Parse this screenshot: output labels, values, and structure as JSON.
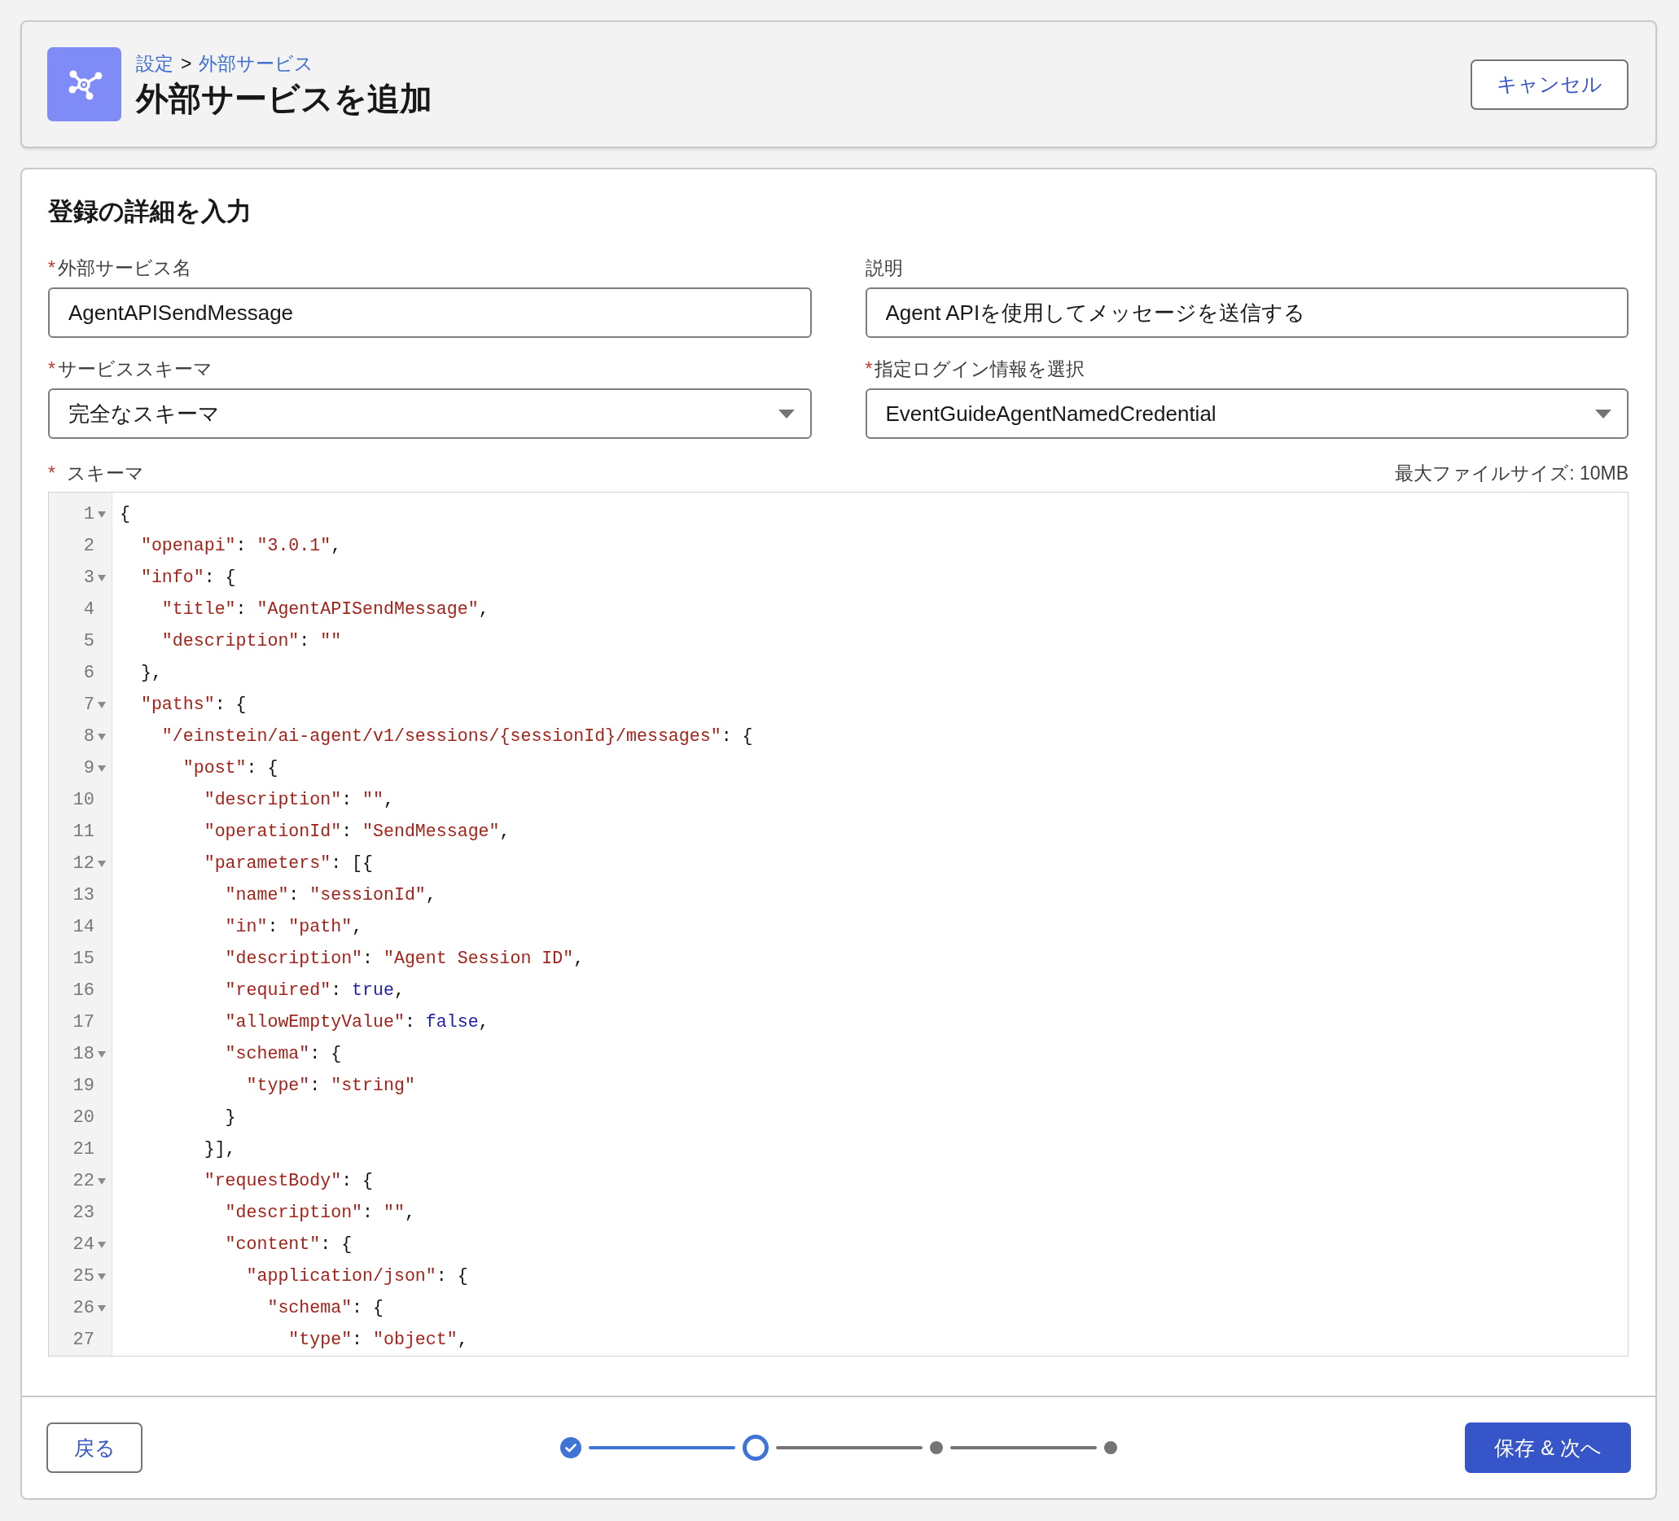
{
  "header": {
    "breadcrumb": [
      {
        "kind": "link",
        "text": "設定"
      },
      {
        "kind": "separator",
        "text": ">"
      },
      {
        "kind": "link",
        "text": "外部サービス"
      }
    ],
    "title": "外部サービスを追加",
    "cancel_button": "キャンセル"
  },
  "form": {
    "heading": "登録の詳細を入力",
    "fields": [
      {
        "kind": "text",
        "required_mark": "*",
        "label": "外部サービス名",
        "value": "AgentAPISendMessage"
      },
      {
        "kind": "text",
        "label": "説明",
        "value": "Agent APIを使用してメッセージを送信する"
      },
      {
        "kind": "select",
        "required_mark": "*",
        "label": "サービススキーマ",
        "value": "完全なスキーマ"
      },
      {
        "kind": "select",
        "required_mark": "*",
        "label": "指定ログイン情報を選択",
        "value": "EventGuideAgentNamedCredential"
      }
    ],
    "schema": {
      "required_mark": "*",
      "label": "スキーマ",
      "note": "最大ファイルサイズ: 10MB",
      "lines": [
        {
          "number": "1",
          "foldable": true,
          "tokens": [
            {
              "kind": "plain",
              "text": "{"
            }
          ]
        },
        {
          "number": "2",
          "foldable": false,
          "tokens": [
            {
              "kind": "string",
              "text": "  \"openapi\""
            },
            {
              "kind": "plain",
              "text": ": "
            },
            {
              "kind": "string",
              "text": "\"3.0.1\""
            },
            {
              "kind": "plain",
              "text": ","
            }
          ]
        },
        {
          "number": "3",
          "foldable": true,
          "tokens": [
            {
              "kind": "string",
              "text": "  \"info\""
            },
            {
              "kind": "plain",
              "text": ": {"
            }
          ]
        },
        {
          "number": "4",
          "foldable": false,
          "tokens": [
            {
              "kind": "string",
              "text": "    \"title\""
            },
            {
              "kind": "plain",
              "text": ": "
            },
            {
              "kind": "string",
              "text": "\"AgentAPISendMessage\""
            },
            {
              "kind": "plain",
              "text": ","
            }
          ]
        },
        {
          "number": "5",
          "foldable": false,
          "tokens": [
            {
              "kind": "string",
              "text": "    \"description\""
            },
            {
              "kind": "plain",
              "text": ": "
            },
            {
              "kind": "string",
              "text": "\"\""
            }
          ]
        },
        {
          "number": "6",
          "foldable": false,
          "tokens": [
            {
              "kind": "plain",
              "text": "  },"
            }
          ]
        },
        {
          "number": "7",
          "foldable": true,
          "tokens": [
            {
              "kind": "string",
              "text": "  \"paths\""
            },
            {
              "kind": "plain",
              "text": ": {"
            }
          ]
        },
        {
          "number": "8",
          "foldable": true,
          "tokens": [
            {
              "kind": "string",
              "text": "    \"/einstein/ai-agent/v1/sessions/{sessionId}/messages\""
            },
            {
              "kind": "plain",
              "text": ": {"
            }
          ]
        },
        {
          "number": "9",
          "foldable": true,
          "tokens": [
            {
              "kind": "string",
              "text": "      \"post\""
            },
            {
              "kind": "plain",
              "text": ": {"
            }
          ]
        },
        {
          "number": "10",
          "foldable": false,
          "tokens": [
            {
              "kind": "string",
              "text": "        \"description\""
            },
            {
              "kind": "plain",
              "text": ": "
            },
            {
              "kind": "string",
              "text": "\"\""
            },
            {
              "kind": "plain",
              "text": ","
            }
          ]
        },
        {
          "number": "11",
          "foldable": false,
          "tokens": [
            {
              "kind": "string",
              "text": "        \"operationId\""
            },
            {
              "kind": "plain",
              "text": ": "
            },
            {
              "kind": "string",
              "text": "\"SendMessage\""
            },
            {
              "kind": "plain",
              "text": ","
            }
          ]
        },
        {
          "number": "12",
          "foldable": true,
          "tokens": [
            {
              "kind": "string",
              "text": "        \"parameters\""
            },
            {
              "kind": "plain",
              "text": ": [{"
            }
          ]
        },
        {
          "number": "13",
          "foldable": false,
          "tokens": [
            {
              "kind": "string",
              "text": "          \"name\""
            },
            {
              "kind": "plain",
              "text": ": "
            },
            {
              "kind": "string",
              "text": "\"sessionId\""
            },
            {
              "kind": "plain",
              "text": ","
            }
          ]
        },
        {
          "number": "14",
          "foldable": false,
          "tokens": [
            {
              "kind": "string",
              "text": "          \"in\""
            },
            {
              "kind": "plain",
              "text": ": "
            },
            {
              "kind": "string",
              "text": "\"path\""
            },
            {
              "kind": "plain",
              "text": ","
            }
          ]
        },
        {
          "number": "15",
          "foldable": false,
          "tokens": [
            {
              "kind": "string",
              "text": "          \"description\""
            },
            {
              "kind": "plain",
              "text": ": "
            },
            {
              "kind": "string",
              "text": "\"Agent Session ID\""
            },
            {
              "kind": "plain",
              "text": ","
            }
          ]
        },
        {
          "number": "16",
          "foldable": false,
          "tokens": [
            {
              "kind": "string",
              "text": "          \"required\""
            },
            {
              "kind": "plain",
              "text": ": "
            },
            {
              "kind": "literal",
              "text": "true"
            },
            {
              "kind": "plain",
              "text": ","
            }
          ]
        },
        {
          "number": "17",
          "foldable": false,
          "tokens": [
            {
              "kind": "string",
              "text": "          \"allowEmptyValue\""
            },
            {
              "kind": "plain",
              "text": ": "
            },
            {
              "kind": "literal",
              "text": "false"
            },
            {
              "kind": "plain",
              "text": ","
            }
          ]
        },
        {
          "number": "18",
          "foldable": true,
          "tokens": [
            {
              "kind": "string",
              "text": "          \"schema\""
            },
            {
              "kind": "plain",
              "text": ": {"
            }
          ]
        },
        {
          "number": "19",
          "foldable": false,
          "tokens": [
            {
              "kind": "string",
              "text": "            \"type\""
            },
            {
              "kind": "plain",
              "text": ": "
            },
            {
              "kind": "string",
              "text": "\"string\""
            }
          ]
        },
        {
          "number": "20",
          "foldable": false,
          "tokens": [
            {
              "kind": "plain",
              "text": "          }"
            }
          ]
        },
        {
          "number": "21",
          "foldable": false,
          "tokens": [
            {
              "kind": "plain",
              "text": "        }],"
            }
          ]
        },
        {
          "number": "22",
          "foldable": true,
          "tokens": [
            {
              "kind": "string",
              "text": "        \"requestBody\""
            },
            {
              "kind": "plain",
              "text": ": {"
            }
          ]
        },
        {
          "number": "23",
          "foldable": false,
          "tokens": [
            {
              "kind": "string",
              "text": "          \"description\""
            },
            {
              "kind": "plain",
              "text": ": "
            },
            {
              "kind": "string",
              "text": "\"\""
            },
            {
              "kind": "plain",
              "text": ","
            }
          ]
        },
        {
          "number": "24",
          "foldable": true,
          "tokens": [
            {
              "kind": "string",
              "text": "          \"content\""
            },
            {
              "kind": "plain",
              "text": ": {"
            }
          ]
        },
        {
          "number": "25",
          "foldable": true,
          "tokens": [
            {
              "kind": "string",
              "text": "            \"application/json\""
            },
            {
              "kind": "plain",
              "text": ": {"
            }
          ]
        },
        {
          "number": "26",
          "foldable": true,
          "tokens": [
            {
              "kind": "string",
              "text": "              \"schema\""
            },
            {
              "kind": "plain",
              "text": ": {"
            }
          ]
        },
        {
          "number": "27",
          "foldable": false,
          "tokens": [
            {
              "kind": "string",
              "text": "                \"type\""
            },
            {
              "kind": "plain",
              "text": ": "
            },
            {
              "kind": "string",
              "text": "\"object\""
            },
            {
              "kind": "plain",
              "text": ","
            }
          ]
        }
      ]
    }
  },
  "footer": {
    "back_button": "戻る",
    "progress": {
      "steps": [
        {
          "done": true,
          "selected": false
        },
        {
          "done": false,
          "selected": true
        },
        {
          "done": false,
          "selected": false
        },
        {
          "done": false,
          "selected": false
        }
      ]
    },
    "next_button": "保存 & 次へ"
  }
}
